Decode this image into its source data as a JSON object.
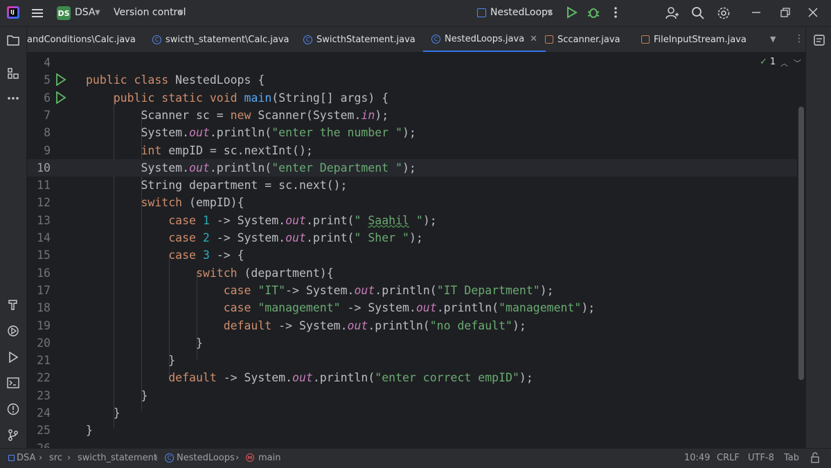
{
  "title_bar": {
    "project_badge": "DS",
    "project_name": "DSA",
    "version_control": "Version control",
    "run_config": "NestedLoops"
  },
  "tabs": [
    {
      "label": "andConditions\\Calc.java",
      "icon": "class-icon"
    },
    {
      "label": "swicth_statement\\Calc.java",
      "icon": "class-icon"
    },
    {
      "label": "SwicthStatement.java",
      "icon": "class-icon"
    },
    {
      "label": "NestedLoops.java",
      "icon": "class-icon",
      "active": true
    },
    {
      "label": "Sccanner.java",
      "icon": "java-file-icon"
    },
    {
      "label": "FileInputStream.java",
      "icon": "java-file-icon"
    }
  ],
  "editor": {
    "inspection_count": "1",
    "current_line": 10,
    "lines": [
      {
        "n": "4",
        "code": ""
      },
      {
        "n": "5",
        "code": "public class NestedLoops {"
      },
      {
        "n": "6",
        "code": "    public static void main(String[] args) {"
      },
      {
        "n": "7",
        "code": "        Scanner sc = new Scanner(System.in);"
      },
      {
        "n": "8",
        "code": "        System.out.println(\"enter the number \");"
      },
      {
        "n": "9",
        "code": "        int empID = sc.nextInt();"
      },
      {
        "n": "10",
        "code": "        System.out.println(\"enter Department \");"
      },
      {
        "n": "11",
        "code": "        String department = sc.next();"
      },
      {
        "n": "12",
        "code": "        switch (empID){"
      },
      {
        "n": "13",
        "code": "            case 1 -> System.out.print(\" Saahil \");"
      },
      {
        "n": "14",
        "code": "            case 2 -> System.out.print(\" Sher \");"
      },
      {
        "n": "15",
        "code": "            case 3 -> {"
      },
      {
        "n": "16",
        "code": "                switch (department){"
      },
      {
        "n": "17",
        "code": "                    case \"IT\"-> System.out.println(\"IT Department\");"
      },
      {
        "n": "18",
        "code": "                    case \"management\" -> System.out.println(\"management\");"
      },
      {
        "n": "19",
        "code": "                    default -> System.out.println(\"no default\");"
      },
      {
        "n": "20",
        "code": "                }"
      },
      {
        "n": "21",
        "code": "            }"
      },
      {
        "n": "22",
        "code": "            default -> System.out.println(\"enter correct empID\");"
      },
      {
        "n": "23",
        "code": "        }"
      },
      {
        "n": "24",
        "code": "    }"
      },
      {
        "n": "25",
        "code": "}"
      },
      {
        "n": "26",
        "code": ""
      }
    ]
  },
  "status_bar": {
    "breadcrumb": [
      "DSA",
      "src",
      "swicth_statement",
      "NestedLoops",
      "main"
    ],
    "position": "10:49",
    "line_separator": "CRLF",
    "encoding": "UTF-8",
    "indent": "Tab"
  },
  "colors": {
    "keyword": "#cf8e6d",
    "string": "#6aab73",
    "number": "#2aacb8",
    "static_field": "#c77dbb",
    "method_decl": "#56a8f5",
    "accent": "#3574f0"
  }
}
